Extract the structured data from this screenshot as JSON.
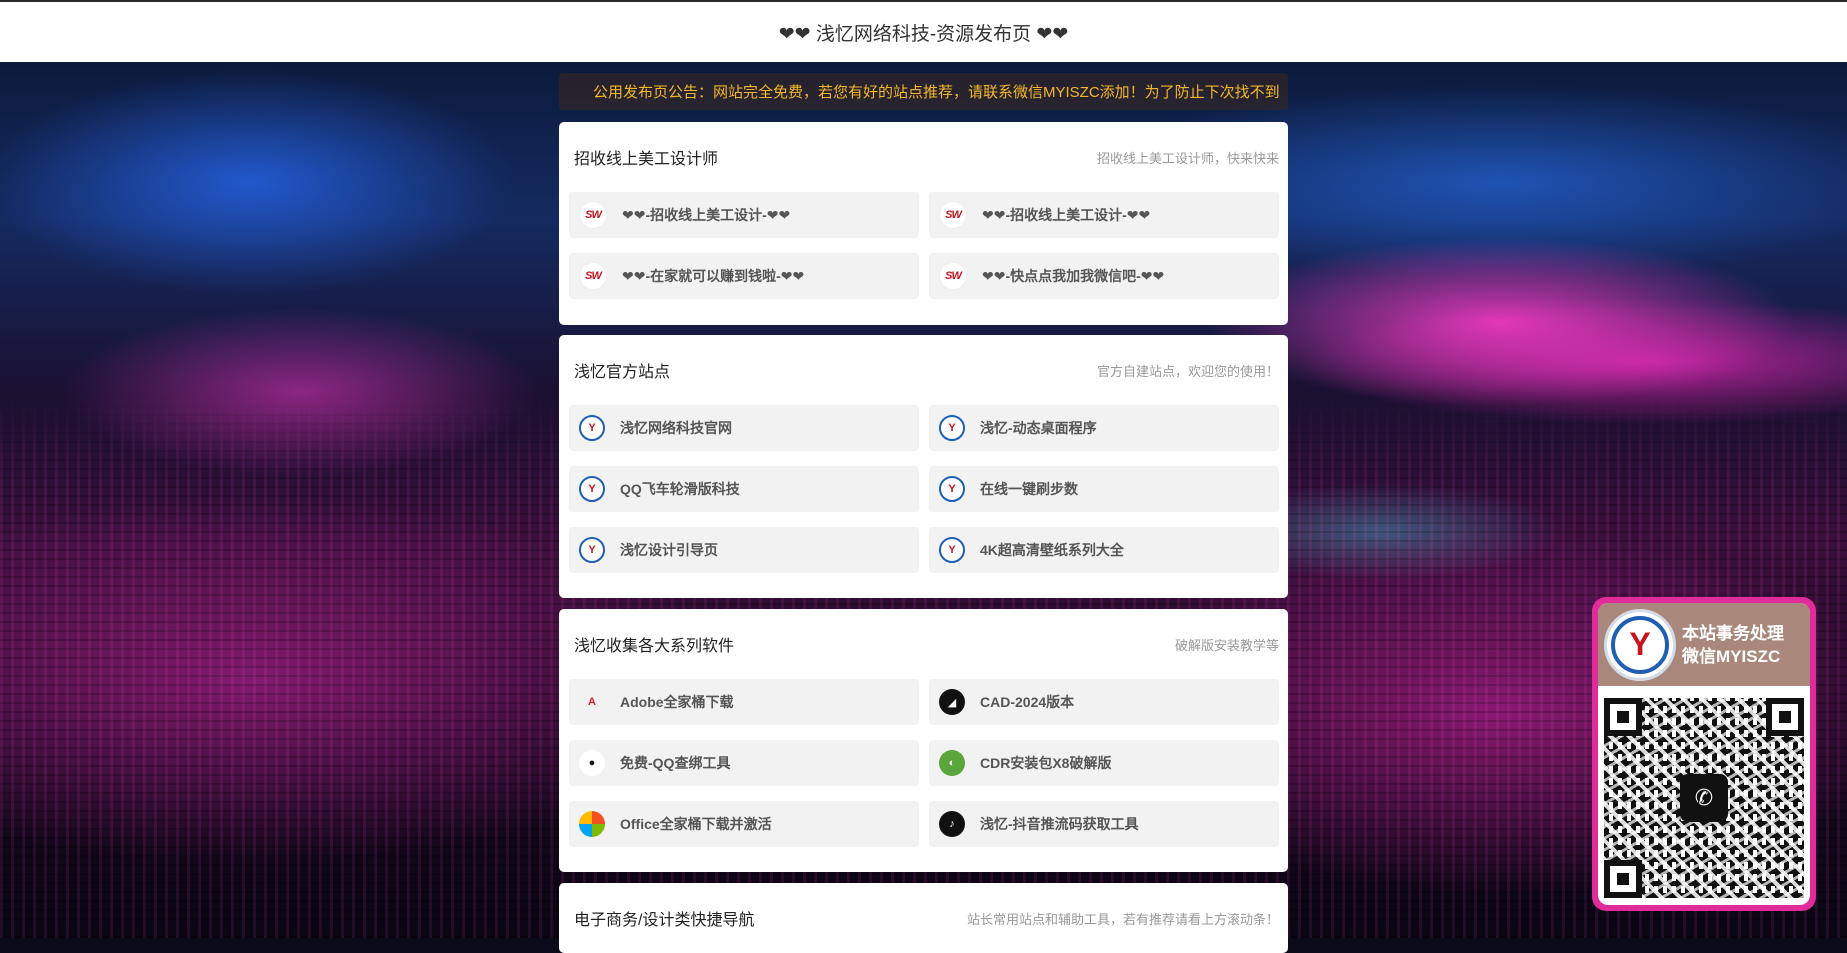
{
  "header": {
    "title": "❤❤ 浅忆网络科技-资源发布页 ❤❤"
  },
  "notice": {
    "text": "公用发布页公告：网站完全免费，若您有好的站点推荐，请联系微信MYISZC添加！为了防止下次找不到"
  },
  "cards": [
    {
      "title": "招收线上美工设计师",
      "desc": "招收线上美工设计师，快来快来",
      "items": [
        {
          "icon": "sw-logo-icon",
          "label": "❤❤-招收线上美工设计-❤❤"
        },
        {
          "icon": "sw-logo-icon",
          "label": "❤❤-招收线上美工设计-❤❤"
        },
        {
          "icon": "sw-logo-icon",
          "label": "❤❤-在家就可以赚到钱啦-❤❤"
        },
        {
          "icon": "sw-logo-icon",
          "label": "❤❤-快点点我加我微信吧-❤❤"
        }
      ]
    },
    {
      "title": "浅忆官方站点",
      "desc": "官方自建站点，欢迎您的使用！",
      "items": [
        {
          "icon": "qianyi-logo-icon",
          "label": "浅忆网络科技官网"
        },
        {
          "icon": "qianyi-logo-icon",
          "label": "浅忆-动态桌面程序"
        },
        {
          "icon": "qianyi-logo-icon",
          "label": "QQ飞车轮滑版科技"
        },
        {
          "icon": "qianyi-logo-icon",
          "label": "在线一键刷步数"
        },
        {
          "icon": "qianyi-logo-icon",
          "label": "浅忆设计引导页"
        },
        {
          "icon": "qianyi-logo-icon",
          "label": "4K超高清壁纸系列大全"
        }
      ]
    },
    {
      "title": "浅忆收集各大系列软件",
      "desc": "破解版安装教学等",
      "items": [
        {
          "icon": "adobe-icon",
          "label": "Adobe全家桶下载"
        },
        {
          "icon": "cad-icon",
          "label": "CAD-2024版本"
        },
        {
          "icon": "qq-penguin-icon",
          "label": "免费-QQ查绑工具"
        },
        {
          "icon": "cdr-icon",
          "label": "CDR安装包X8破解版"
        },
        {
          "icon": "office-icon",
          "label": "Office全家桶下载并激活"
        },
        {
          "icon": "douyin-icon",
          "label": "浅忆-抖音推流码获取工具"
        }
      ]
    },
    {
      "title": "电子商务/设计类快捷导航",
      "desc": "站长常用站点和辅助工具，若有推荐请看上方滚动条！",
      "items": []
    }
  ],
  "qr_widget": {
    "line1": "本站事务处理",
    "line2": "微信MYISZC",
    "icon": "wechat-icon"
  }
}
